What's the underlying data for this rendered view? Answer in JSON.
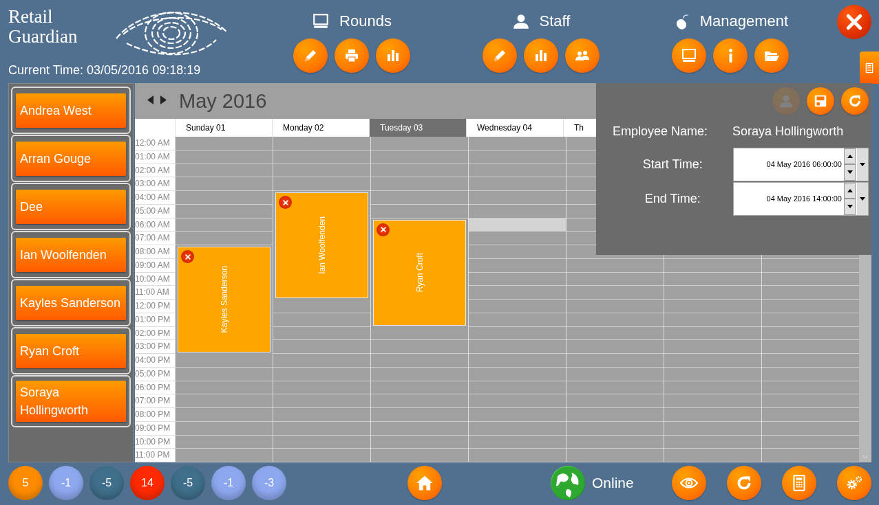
{
  "brand": {
    "name": "Retail Guardian"
  },
  "current_time": {
    "label": "Current Time:",
    "value": "03/05/2016 09:18:19"
  },
  "menu_groups": [
    {
      "title": "Rounds",
      "kind": "monitor",
      "buttons": [
        {
          "kind": "pencil"
        },
        {
          "kind": "printer"
        },
        {
          "kind": "chart"
        }
      ]
    },
    {
      "title": "Staff",
      "kind": "person",
      "buttons": [
        {
          "kind": "pencil"
        },
        {
          "kind": "chart"
        },
        {
          "kind": "people"
        }
      ]
    },
    {
      "title": "Management",
      "kind": "mouse",
      "buttons": [
        {
          "kind": "monitor"
        },
        {
          "kind": "info"
        },
        {
          "kind": "folder"
        }
      ]
    }
  ],
  "staff": [
    {
      "name": "Andrea West"
    },
    {
      "name": "Arran Gouge"
    },
    {
      "name": "Dee"
    },
    {
      "name": "Ian Woolfenden"
    },
    {
      "name": "Kayles Sanderson"
    },
    {
      "name": "Ryan Croft"
    },
    {
      "name": "Soraya Hollingworth"
    }
  ],
  "calendar": {
    "month": "May 2016",
    "hours": [
      "12:00 AM",
      "01:00 AM",
      "02:00 AM",
      "03:00 AM",
      "04:00 AM",
      "05:00 AM",
      "06:00 AM",
      "07:00 AM",
      "08:00 AM",
      "09:00 AM",
      "10:00 AM",
      "11:00 AM",
      "12:00 PM",
      "01:00 PM",
      "02:00 PM",
      "03:00 PM",
      "04:00 PM",
      "05:00 PM",
      "06:00 PM",
      "07:00 PM",
      "08:00 PM",
      "09:00 PM",
      "10:00 PM",
      "11:00 PM"
    ],
    "days": [
      {
        "label": "Sunday 01",
        "selected": false,
        "events": [
          {
            "name": "Kayles Sanderson"
          }
        ]
      },
      {
        "label": "Monday 02",
        "selected": false,
        "events": [
          {
            "name": "Ian Woolfenden"
          }
        ]
      },
      {
        "label": "Tuesday 03",
        "selected": true,
        "events": [
          {
            "name": "Ryan Croft"
          }
        ]
      },
      {
        "label": "Wednesday 04",
        "selected": false,
        "slot_selected": true
      },
      {
        "label": "Th",
        "selected": false
      }
    ]
  },
  "editor": {
    "buttons": [
      {
        "kind": "person",
        "disabled": true
      },
      {
        "kind": "save",
        "disabled": false
      },
      {
        "kind": "refresh",
        "disabled": false
      }
    ],
    "name_label": "Employee Name:",
    "name_value": "Soraya Hollingworth",
    "fields": [
      {
        "label": "Start Time:",
        "value": "04 May 2016 06:00:00"
      },
      {
        "label": "End Time:",
        "value": "04 May 2016 14:00:00"
      }
    ]
  },
  "counters": [
    {
      "value": "5",
      "color": "#ff8c00"
    },
    {
      "value": "-1",
      "color": "#8ea8f0"
    },
    {
      "value": "-5",
      "color": "#3f6f8a"
    },
    {
      "value": "14",
      "color": "#ff2a00"
    },
    {
      "value": "-5",
      "color": "#3f6f8a"
    },
    {
      "value": "-1",
      "color": "#8ea8f0"
    },
    {
      "value": "-3",
      "color": "#8ea8f0"
    }
  ],
  "status": {
    "label": "Online"
  },
  "tools": [
    {
      "kind": "eye"
    },
    {
      "kind": "refresh"
    },
    {
      "kind": "calculator"
    },
    {
      "kind": "gear"
    }
  ]
}
